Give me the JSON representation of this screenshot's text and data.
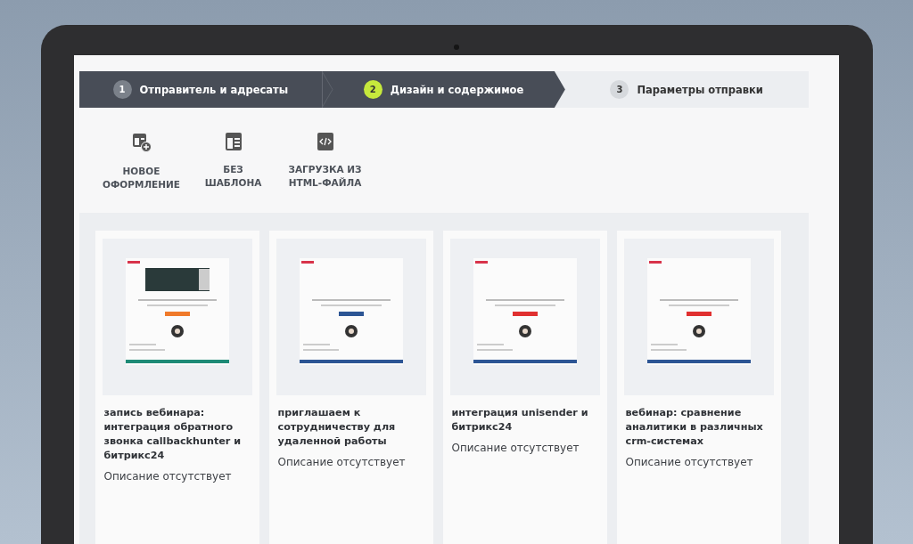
{
  "steps": [
    {
      "number": "1",
      "label": "Отправитель и адресаты",
      "completed": true,
      "selected": false
    },
    {
      "number": "2",
      "label": "Дизайн и содержимое",
      "completed": true,
      "selected": true
    },
    {
      "number": "3",
      "label": "Параметры отправки",
      "completed": false,
      "selected": false
    }
  ],
  "options": [
    {
      "kind": "new",
      "label": "НОВОЕ ОФОРМЛЕНИЕ"
    },
    {
      "kind": "blank",
      "label": "БЕЗ ШАБЛОНА"
    },
    {
      "kind": "html",
      "label": "ЗАГРУЗКА ИЗ HTML-ФАЙЛА"
    }
  ],
  "templates": [
    {
      "title": "запись вебинара: интеграция обратного звонка callbackhunter и битрикс24",
      "description": "Описание отсутствует"
    },
    {
      "title": "приглашаем к сотрудничеству для удаленной работы",
      "description": "Описание отсутствует"
    },
    {
      "title": "интеграция unisender и битрикс24",
      "description": "Описание отсутствует"
    },
    {
      "title": "вебинар: сравнение аналитики в различных crm-системах",
      "description": "Описание отсутствует"
    }
  ]
}
